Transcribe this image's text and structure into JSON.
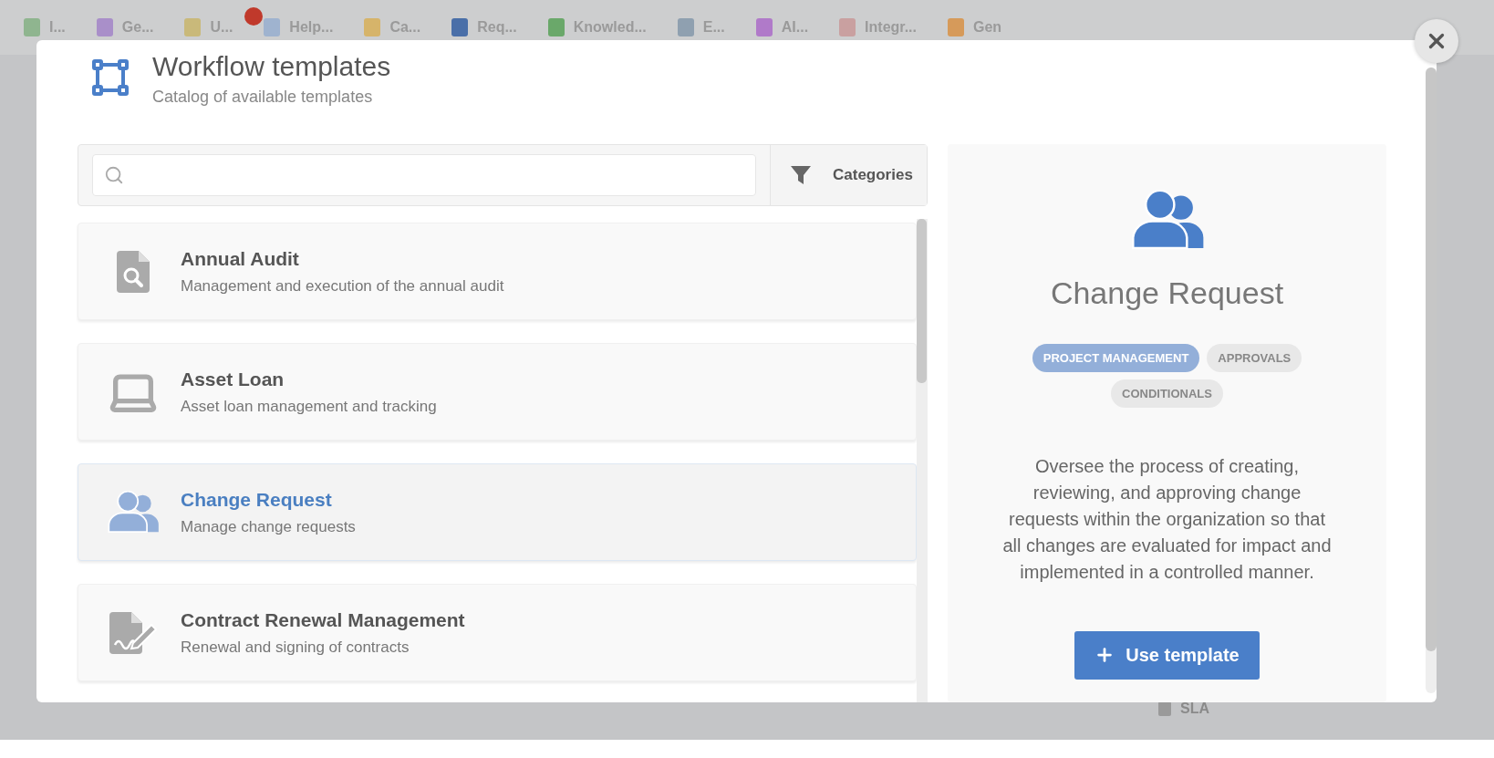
{
  "background": {
    "tabs": [
      {
        "label": "I...",
        "color": "#8fb58f"
      },
      {
        "label": "Ge...",
        "color": "#a98fc9"
      },
      {
        "label": "U...",
        "color": "#c9b97a"
      },
      {
        "label": "Help...",
        "color": "#9fb3cf"
      },
      {
        "label": "Ca...",
        "color": "#d6b46a"
      },
      {
        "label": "Req...",
        "color": "#4a6fa8"
      },
      {
        "label": "Knowled...",
        "color": "#6aa86a"
      },
      {
        "label": "E...",
        "color": "#8fa0b0"
      },
      {
        "label": "AI...",
        "color": "#b07ac9"
      },
      {
        "label": "Integr...",
        "color": "#c9a0a0"
      },
      {
        "label": "Gen",
        "color": "#d69a5a"
      }
    ],
    "footer_item": "SLA"
  },
  "dialog": {
    "title": "Workflow templates",
    "subtitle": "Catalog of available templates",
    "filter_button": "Categories",
    "templates": [
      {
        "name": "Annual Audit",
        "description": "Management and execution of the annual audit",
        "kind": "document-search",
        "selected": false
      },
      {
        "name": "Asset Loan",
        "description": "Asset loan management and tracking",
        "kind": "laptop",
        "selected": false
      },
      {
        "name": "Change Request",
        "description": "Manage change requests",
        "kind": "users",
        "selected": true
      },
      {
        "name": "Contract Renewal Management",
        "description": "Renewal and signing of contracts",
        "kind": "file-signature",
        "selected": false
      }
    ],
    "detail": {
      "kind": "users",
      "title": "Change Request",
      "tags": [
        {
          "label": "PROJECT MANAGEMENT",
          "kind": "primary"
        },
        {
          "label": "APPROVALS",
          "kind": "secondary"
        },
        {
          "label": "CONDITIONALS",
          "kind": "secondary"
        }
      ],
      "description": "Oversee the process of creating, reviewing, and approving change requests within the organization so that all changes are evaluated for impact and implemented in a controlled manner.",
      "action": "Use template"
    }
  }
}
